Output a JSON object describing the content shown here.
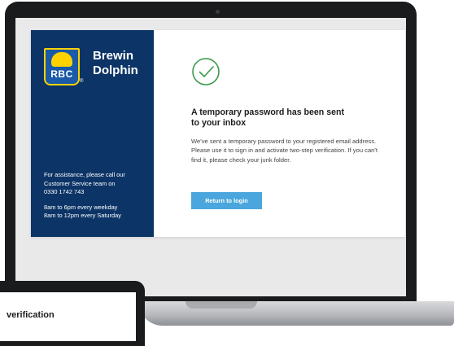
{
  "brand": {
    "logo_text": "RBC",
    "name_line1": "Brewin",
    "name_line2": "Dolphin"
  },
  "sidebar": {
    "assist_line1": "For assistance, please call our",
    "assist_line2": "Customer Service team on",
    "phone": "0330 1742 743",
    "hours_weekday": "8am to 6pm every weekday",
    "hours_saturday": "8am to 12pm every Saturday"
  },
  "main": {
    "icon": "check-circle-icon",
    "title": "A temporary password has been sent to your inbox",
    "message": "We've sent a temporary password to your registered email address. Please use it to sign in and activate two-step verification. If you can't find it, please check your junk folder.",
    "button_label": "Return to login"
  },
  "second_device": {
    "heading_fragment": "verification"
  },
  "colors": {
    "sidebar_bg": "#0c3466",
    "accent_green": "#3a9a4a",
    "button_blue": "#4aa6dc"
  }
}
